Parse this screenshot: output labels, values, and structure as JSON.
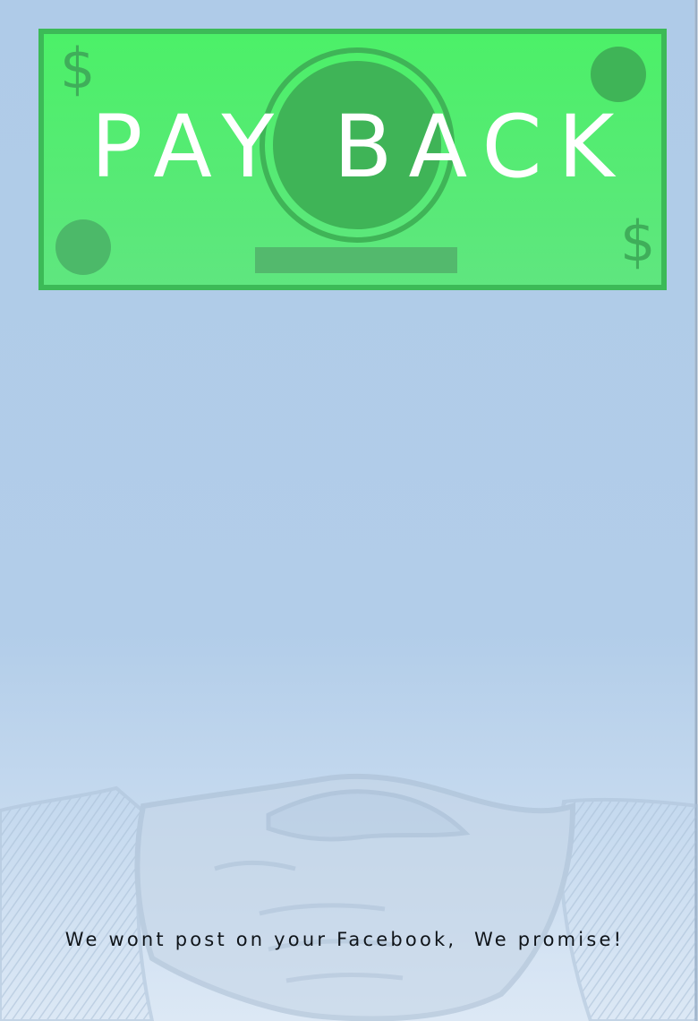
{
  "bill": {
    "title": "PAY BACK",
    "currency_symbol_top_left": "$",
    "currency_symbol_bottom_right": "$",
    "icon": "dollar-bill-icon"
  },
  "background": {
    "illustration": "handshake-icon"
  },
  "footer": {
    "tagline": "We wont post on your Facebook,  We promise!"
  },
  "colors": {
    "bill_green": "#4cf068",
    "bill_border": "#3cba57",
    "background_blue": "#afcbe8",
    "title_white": "#ffffff"
  }
}
